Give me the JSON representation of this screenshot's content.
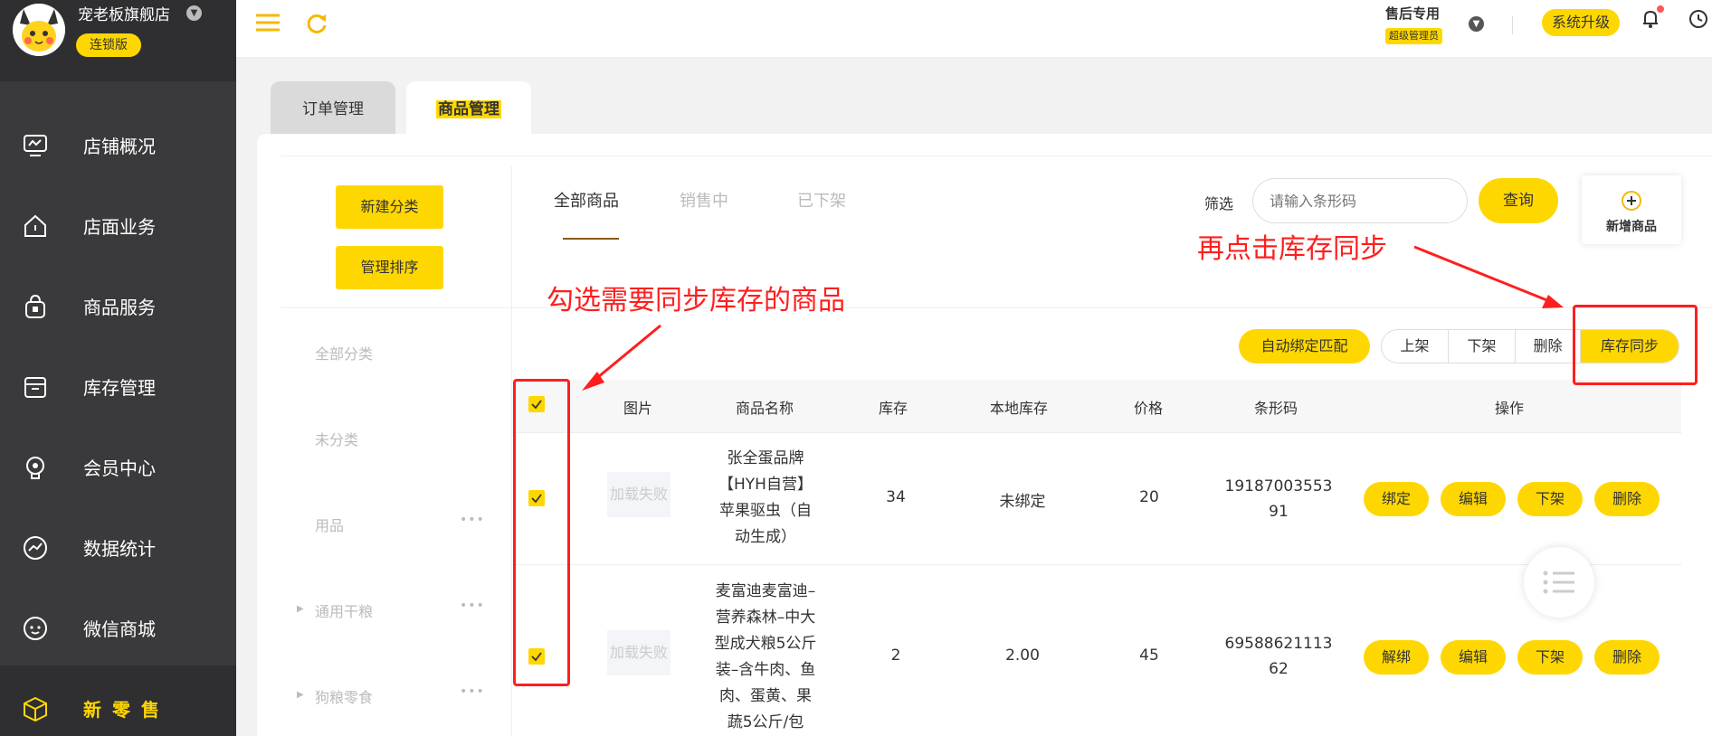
{
  "sidebar": {
    "store_name": "宠老板旗舰店",
    "edition": "连锁版",
    "items": [
      {
        "label": "店铺概况",
        "icon": "monitor-icon"
      },
      {
        "label": "店面业务",
        "icon": "home-icon"
      },
      {
        "label": "商品服务",
        "icon": "bag-icon"
      },
      {
        "label": "库存管理",
        "icon": "box-icon"
      },
      {
        "label": "会员中心",
        "icon": "member-icon"
      },
      {
        "label": "数据统计",
        "icon": "chart-icon"
      },
      {
        "label": "微信商城",
        "icon": "chat-icon"
      },
      {
        "label": "新零售",
        "icon": "cube-icon",
        "active": true
      }
    ]
  },
  "header": {
    "role_title": "售后专用",
    "role_badge": "超级管理员",
    "upgrade_label": "系统升级"
  },
  "main_tabs": [
    {
      "label": "订单管理",
      "active": false
    },
    {
      "label": "商品管理",
      "active": true
    }
  ],
  "category_panel": {
    "new_category_label": "新建分类",
    "sort_label": "管理排序",
    "categories": [
      {
        "label": "全部分类"
      },
      {
        "label": "未分类"
      },
      {
        "label": "用品",
        "more": "•••"
      },
      {
        "label": "通用干粮",
        "more": "•••"
      },
      {
        "label": "狗粮零食",
        "more": "•••"
      }
    ]
  },
  "product_tabs": [
    "全部商品",
    "销售中",
    "已下架"
  ],
  "filter": {
    "label": "筛选",
    "placeholder": "请输入条形码",
    "query_label": "查询"
  },
  "add_product_label": "新增商品",
  "actions": {
    "auto_bind": "自动绑定匹配",
    "group": [
      "上架",
      "下架",
      "删除",
      "库存同步"
    ]
  },
  "table": {
    "headers": [
      "图片",
      "商品名称",
      "库存",
      "本地库存",
      "价格",
      "条形码",
      "操作"
    ],
    "rows": [
      {
        "image": "加载失败",
        "name_lines": [
          "张全蛋品牌",
          "【HYH自营】",
          "苹果驱虫（自",
          "动生成）"
        ],
        "stock": "34",
        "local_stock": "未绑定",
        "price": "20",
        "barcode_lines": [
          "19187003553",
          "91"
        ],
        "ops": [
          "绑定",
          "编辑",
          "下架",
          "删除"
        ],
        "checked": true
      },
      {
        "image": "加载失败",
        "name_lines": [
          "麦富迪麦富迪–",
          "营养森林–中大",
          "型成犬粮5公斤",
          "装–含牛肉、鱼",
          "肉、蛋黄、果",
          "蔬5公斤/包"
        ],
        "stock": "2",
        "local_stock": "2.00",
        "price": "45",
        "barcode_lines": [
          "69588621113",
          "62"
        ],
        "ops": [
          "解绑",
          "编辑",
          "下架",
          "删除"
        ],
        "checked": true
      }
    ]
  },
  "annotations": {
    "select_hint": "勾选需要同步库存的商品",
    "sync_hint": "再点击库存同步"
  },
  "colors": {
    "accent": "#ffd700",
    "sidebar": "#3a3a3c",
    "annotation": "#ff1e1e"
  }
}
